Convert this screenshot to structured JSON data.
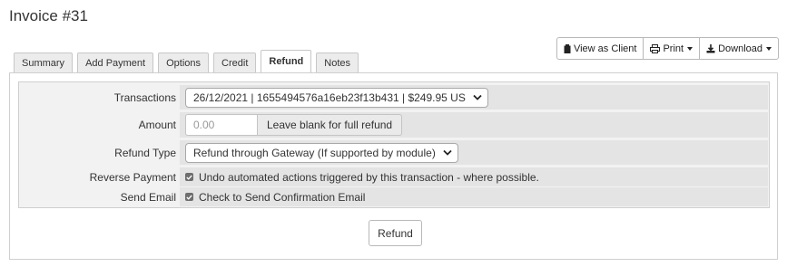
{
  "page": {
    "title": "Invoice #31"
  },
  "toolbar": {
    "view_as_client": "View as Client",
    "print": "Print",
    "download": "Download"
  },
  "tabs": [
    {
      "label": "Summary",
      "active": false
    },
    {
      "label": "Add Payment",
      "active": false
    },
    {
      "label": "Options",
      "active": false
    },
    {
      "label": "Credit",
      "active": false
    },
    {
      "label": "Refund",
      "active": true
    },
    {
      "label": "Notes",
      "active": false
    }
  ],
  "refund_form": {
    "transactions": {
      "label": "Transactions",
      "value": "26/12/2021 | 1655494576a16eb23f13b431 | $249.95 US"
    },
    "amount": {
      "label": "Amount",
      "placeholder": "0.00",
      "hint": "Leave blank for full refund"
    },
    "refund_type": {
      "label": "Refund Type",
      "value": "Refund through Gateway (If supported by module)"
    },
    "reverse_payment": {
      "label": "Reverse Payment",
      "checkbox_text": "Undo automated actions triggered by this transaction - where possible.",
      "checked": true
    },
    "send_email": {
      "label": "Send Email",
      "checkbox_text": "Check to Send Confirmation Email",
      "checked": true
    },
    "submit_label": "Refund"
  },
  "icons": {
    "view_as_client": "clipboard-icon",
    "print": "printer-icon",
    "download": "download-icon",
    "select": "chevron-down-icon",
    "checkbox": "checkmark-icon"
  }
}
